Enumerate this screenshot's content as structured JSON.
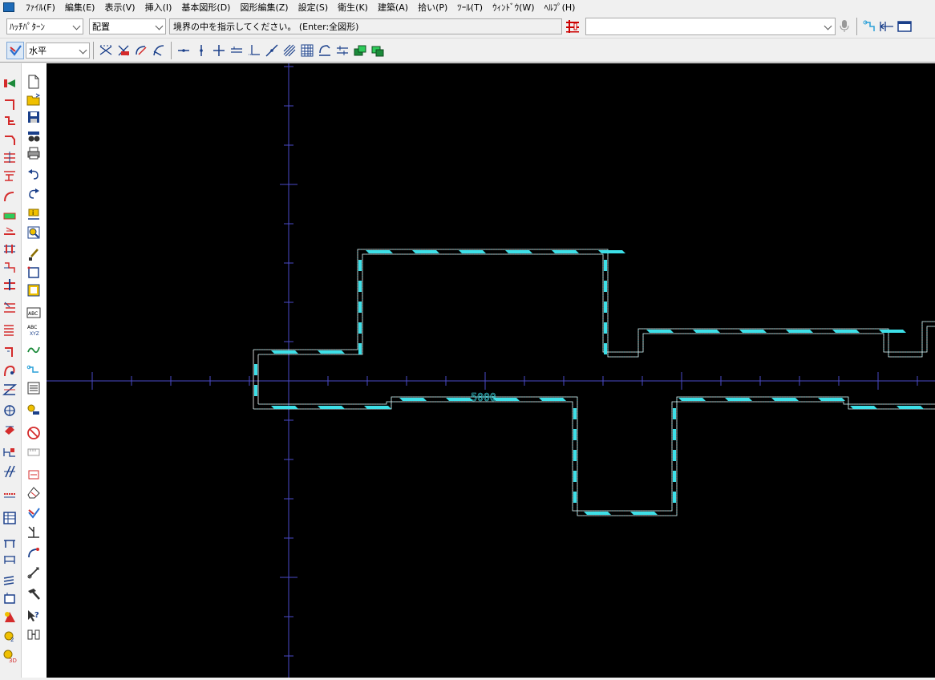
{
  "menu": {
    "items": [
      "ﾌｧｲﾙ(F)",
      "編集(E)",
      "表示(V)",
      "挿入(I)",
      "基本図形(D)",
      "図形編集(Z)",
      "設定(S)",
      "衛生(K)",
      "建築(A)",
      "拾い(P)",
      "ﾂｰﾙ(T)",
      "ｳｨﾝﾄﾞｳ(W)",
      "ﾍﾙﾌﾟ(H)"
    ]
  },
  "toolbar1": {
    "hatch_pattern": "ﾊｯﾁﾊﾟﾀｰﾝ",
    "placement": "配置",
    "prompt": "境界の中を指示してください。 (Enter:全図形)",
    "command_value": ""
  },
  "toolbar2": {
    "direction": "水平"
  },
  "canvas": {
    "dimension_text": "5000",
    "colors": {
      "background": "#000000",
      "wall": "#3de0e8",
      "axis": "#4a4ac8"
    }
  },
  "icons": {
    "palette1": [
      "valve-icon",
      "elbow-icon",
      "branch-icon",
      "bend-icon",
      "tee-icon",
      "fitting-icon",
      "curve-pipe-icon",
      "equipment-icon",
      "reducer-icon",
      "joint-icon",
      "flange-icon",
      "riser-icon",
      "hanger-icon",
      "stair-icon",
      "pipe-bend-icon",
      "trap-icon",
      "cross-icon",
      "circle-valve-icon",
      "pump-icon",
      "gate-valve-icon",
      "slash-icon",
      "dash-icon",
      "table-icon",
      "fixture-icon",
      "bath-icon",
      "layer-icon",
      "mark-icon",
      "gear-icon",
      "gear-3d-icon"
    ],
    "palette2": [
      "new-file-icon",
      "open-folder-icon",
      "save-icon",
      "find-icon",
      "print-icon",
      "undo-icon",
      "redo-icon",
      "info-icon",
      "zoom-icon",
      "brush-icon",
      "square-icon",
      "frame-icon",
      "text-abc-icon",
      "text-xyz-icon",
      "snake-icon",
      "line-icon",
      "list-icon",
      "pin-icon",
      "no-entry-icon",
      "ruler-icon",
      "tag-icon",
      "eraser-icon",
      "hatch-check-icon",
      "perpendicular-icon",
      "arc-icon",
      "measure-icon",
      "hammer-icon",
      "help-icon",
      "scale-icon"
    ]
  }
}
